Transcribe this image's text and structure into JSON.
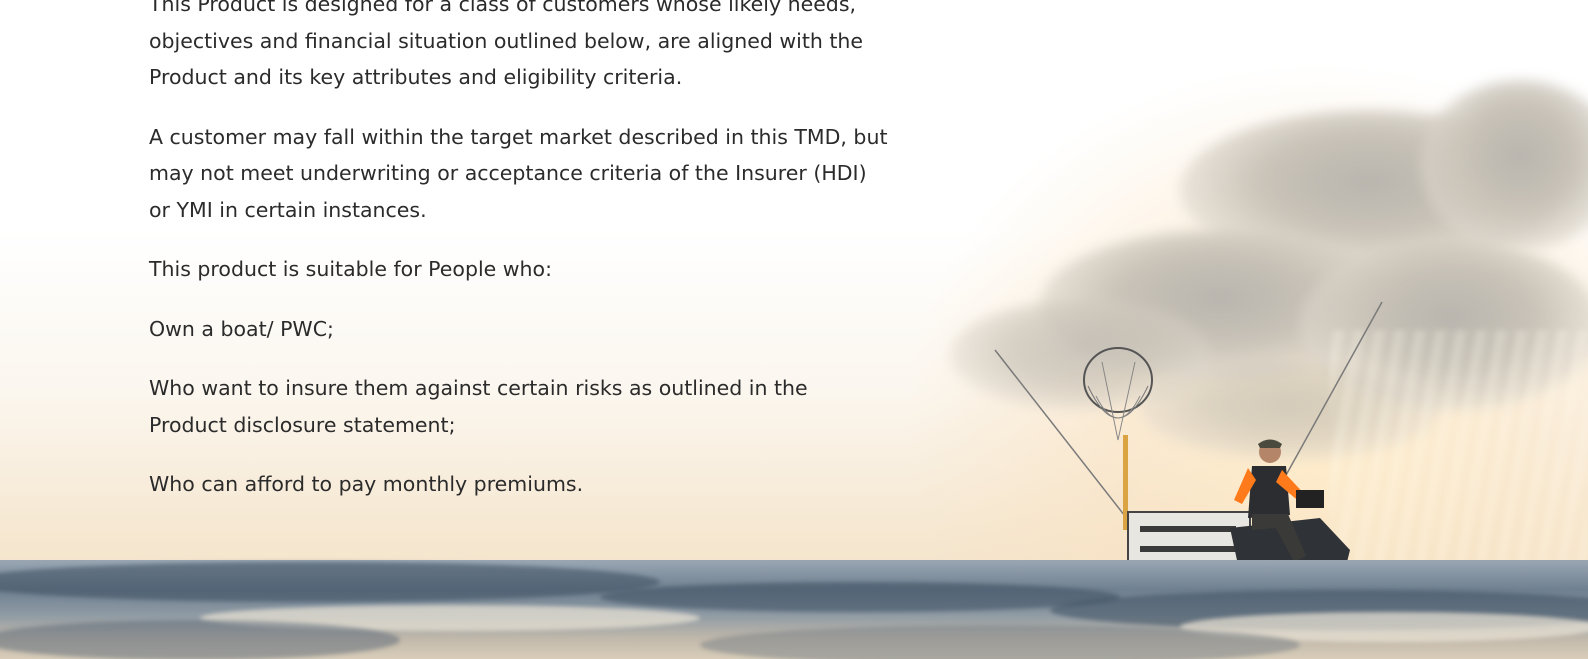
{
  "content": {
    "paragraphs": [
      "This Product is designed for a class of customers whose likely needs, objectives and financial situation outlined below, are aligned with the Product and its key attributes and eligibility criteria.",
      "A customer may fall within the target market described in this TMD, but may not meet underwriting or acceptance criteria of the Insurer (HDI) or YMI in certain instances.",
      "This product is suitable for People who:",
      "Own a boat/ PWC;",
      "Who want to insure them against certain risks as outlined in the Product disclosure statement;",
      "Who can afford to pay monthly premiums."
    ]
  },
  "image": {
    "subject": "person-on-jet-ski-fishing-at-sunset",
    "colors": {
      "text": "#2b2b2b",
      "sky_warm": "#f6e8d2",
      "water": "#6f8090",
      "vest_orange": "#ff7a1a"
    }
  }
}
